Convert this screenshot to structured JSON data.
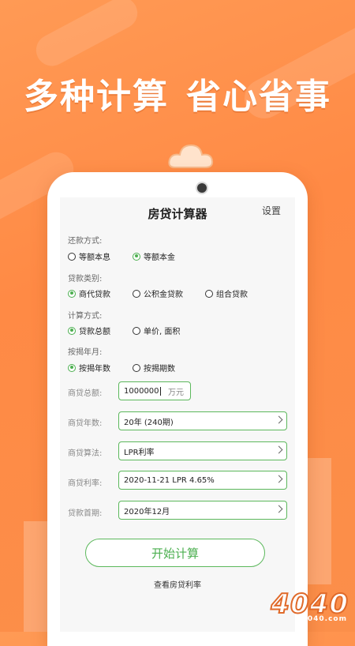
{
  "banner": {
    "left": "多种计算",
    "right": "省心省事"
  },
  "app": {
    "title": "房贷计算器",
    "settings": "设置"
  },
  "repayment": {
    "label": "还款方式:",
    "options": [
      "等额本息",
      "等额本金"
    ],
    "selected": 1
  },
  "loan_type": {
    "label": "贷款类别:",
    "options": [
      "商代贷款",
      "公积金贷款",
      "组合贷款"
    ],
    "selected": 0
  },
  "calc_method": {
    "label": "计算方式:",
    "options": [
      "贷款总额",
      "单价, 面积"
    ],
    "selected": 0
  },
  "mortgage_term": {
    "label": "按揭年月:",
    "options": [
      "按揭年数",
      "按揭期数"
    ],
    "selected": 0
  },
  "fields": {
    "total": {
      "label": "商贷总额:",
      "value": "1000000",
      "unit": "万元"
    },
    "years": {
      "label": "商贷年数:",
      "value": "20年 (240期)"
    },
    "algorithm": {
      "label": "商贷算法:",
      "value": "LPR利率"
    },
    "rate": {
      "label": "商贷利率:",
      "value": "2020-11-21 LPR  4.65%"
    },
    "first": {
      "label": "贷款首期:",
      "value": "2020年12月"
    }
  },
  "actions": {
    "start": "开始计算",
    "view_rate": "查看房贷利率"
  },
  "watermark": {
    "logo": "4040",
    "site": "4040.com"
  },
  "colors": {
    "accent": "#4caf50",
    "background": "#ff8a45"
  }
}
